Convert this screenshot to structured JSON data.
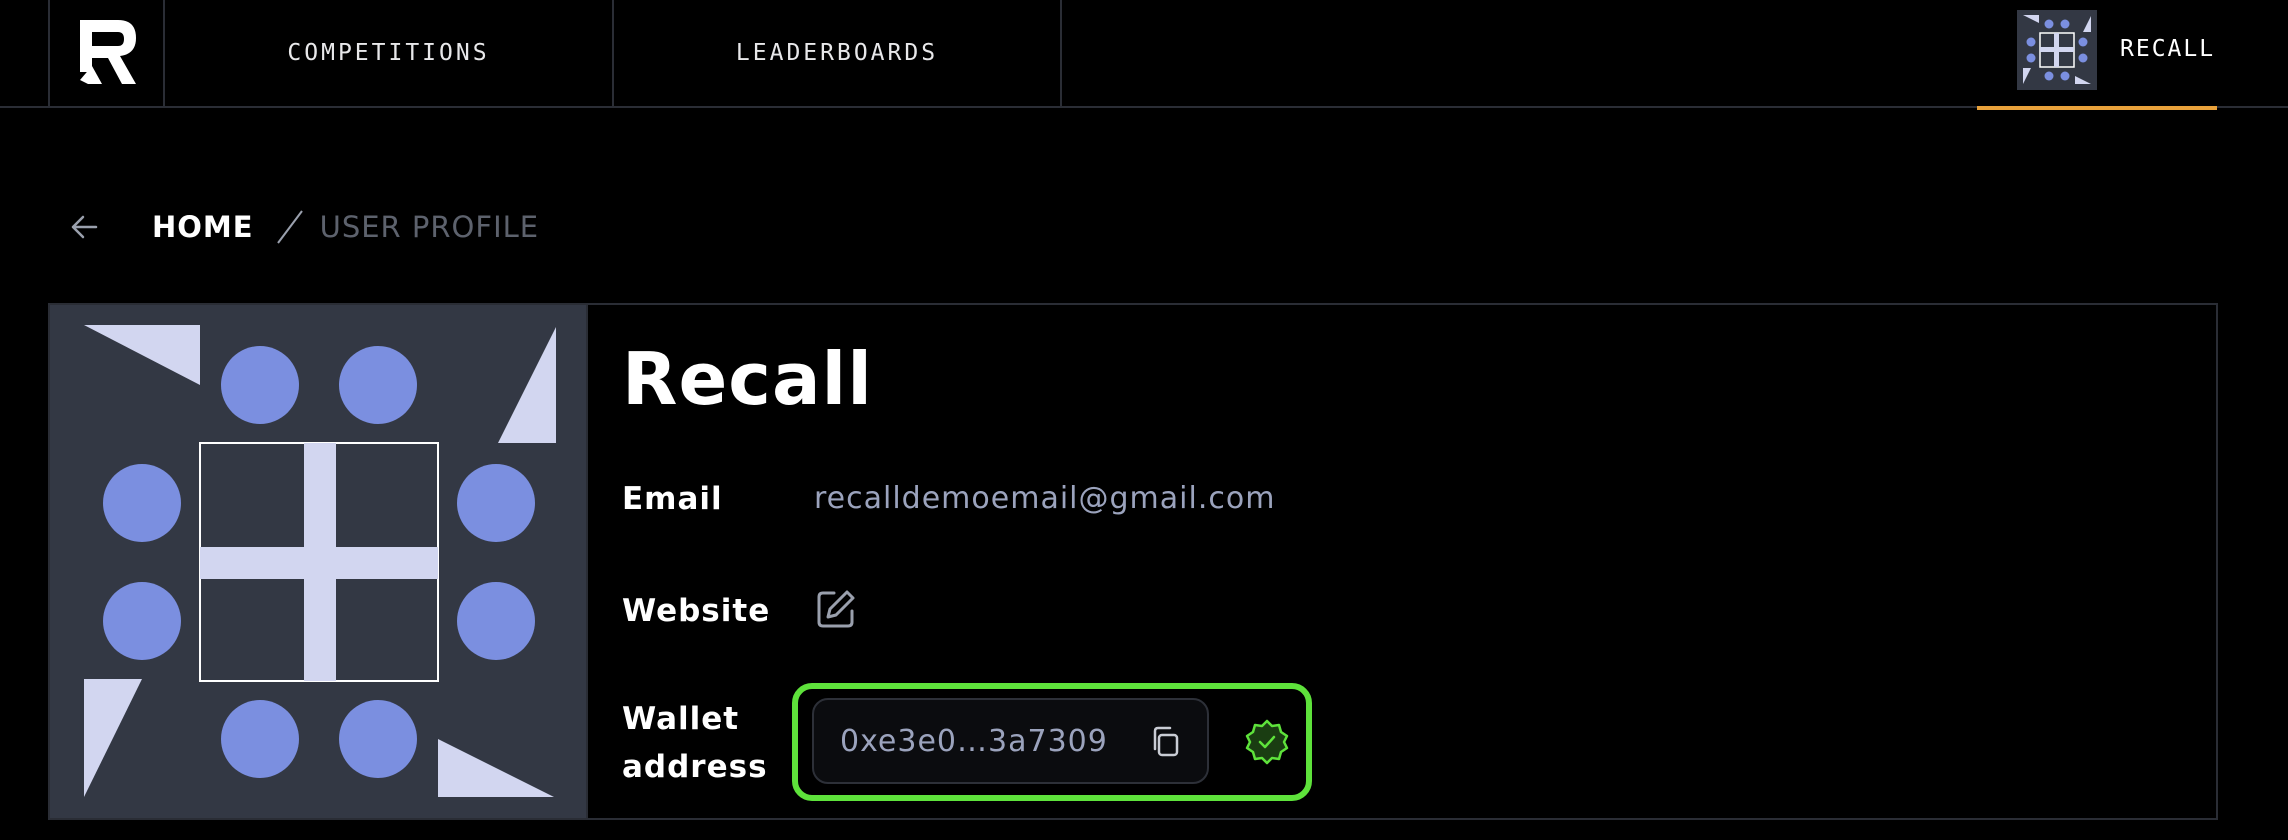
{
  "nav": {
    "links": [
      {
        "label": "COMPETITIONS"
      },
      {
        "label": "LEADERBOARDS"
      }
    ],
    "user": {
      "name": "RECALL"
    }
  },
  "breadcrumb": {
    "home": "HOME",
    "current": "USER PROFILE"
  },
  "profile": {
    "name": "Recall",
    "fields": {
      "email_label": "Email",
      "email_value": "recalldemoemail@gmail.com",
      "website_label": "Website",
      "wallet_label": "Wallet address",
      "wallet_value": "0xe3e0…3a7309"
    }
  },
  "colors": {
    "accent": "#e9a23b",
    "highlight": "#5ee23b",
    "avatar_bg": "#333844",
    "avatar_circle": "#7b8fe0",
    "avatar_shape": "#d2d6f0"
  }
}
